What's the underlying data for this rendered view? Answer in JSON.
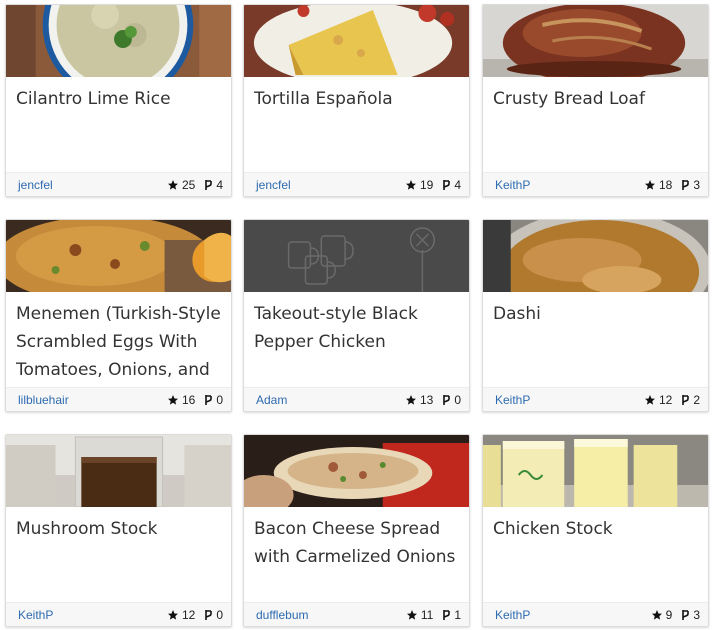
{
  "recipes": [
    {
      "title": "Cilantro Lime Rice",
      "author": "jencfel",
      "stars": "25",
      "forks": "4"
    },
    {
      "title": "Tortilla Española",
      "author": "jencfel",
      "stars": "19",
      "forks": "4"
    },
    {
      "title": "Crusty Bread Loaf",
      "author": "KeithP",
      "stars": "18",
      "forks": "3"
    },
    {
      "title": "Menemen (Turkish-Style Scrambled Eggs With Tomatoes, Onions, and",
      "author": "lilbluehair",
      "stars": "16",
      "forks": "0"
    },
    {
      "title": "Takeout-style Black Pepper Chicken",
      "author": "Adam",
      "stars": "13",
      "forks": "0"
    },
    {
      "title": "Dashi",
      "author": "KeithP",
      "stars": "12",
      "forks": "2"
    },
    {
      "title": "Mushroom Stock",
      "author": "KeithP",
      "stars": "12",
      "forks": "0"
    },
    {
      "title": "Bacon Cheese Spread with Carmelized Onions",
      "author": "dufflebum",
      "stars": "11",
      "forks": "1"
    },
    {
      "title": "Chicken Stock",
      "author": "KeithP",
      "stars": "9",
      "forks": "3"
    }
  ],
  "colors": {
    "author_link": "#2e6bb0",
    "title_text": "#333333",
    "footer_bg": "#f7f7f7"
  },
  "icons": {
    "stars": "star-icon",
    "forks": "fork-icon"
  }
}
